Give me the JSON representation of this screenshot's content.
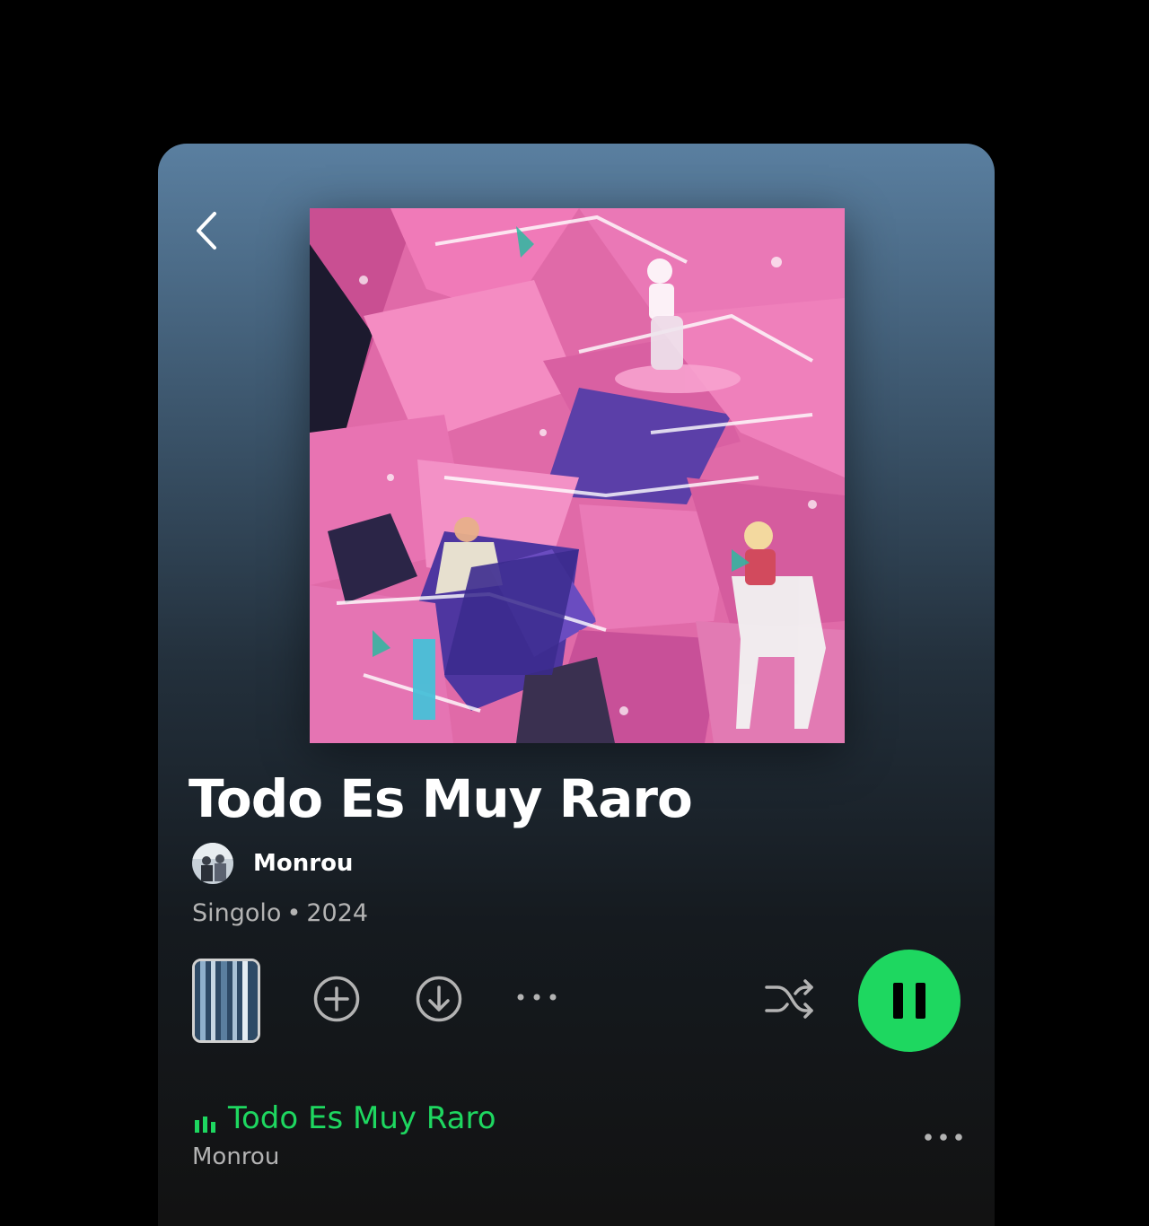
{
  "album": {
    "title": "Todo Es Muy Raro",
    "artist": "Monrou",
    "type": "Singolo",
    "separator": "•",
    "year": "2024"
  },
  "icons": {
    "back": "chevron-left-icon",
    "add": "plus-circle-icon",
    "download": "download-circle-icon",
    "more": "more-horizontal-icon",
    "shuffle": "shuffle-icon",
    "pause": "pause-icon",
    "now_playing": "equalizer-icon"
  },
  "colors": {
    "accent": "#1ed760",
    "header_gradient_top": "#5a7fa0",
    "background": "#121212",
    "secondary_text": "#b3b3b3"
  },
  "tracks": [
    {
      "title": "Todo Es Muy Raro",
      "artist": "Monrou",
      "playing": true
    }
  ]
}
